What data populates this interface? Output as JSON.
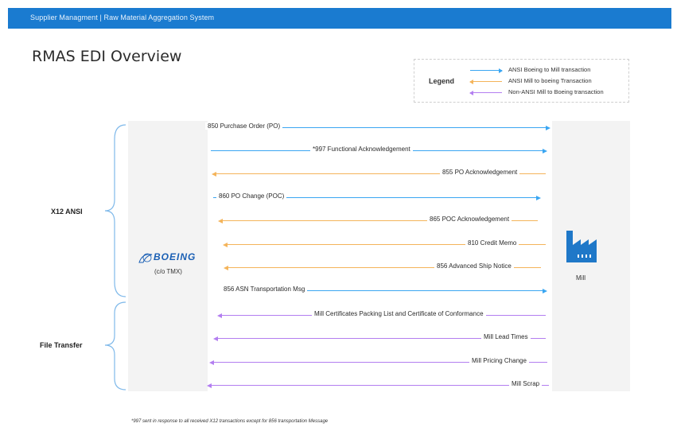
{
  "header": {
    "title": "Supplier Managment | Raw Material Aggregation System"
  },
  "page": {
    "title": "RMAS EDI Overview"
  },
  "legend": {
    "title": "Legend",
    "items": [
      {
        "label": "ANSI Boeing to Mill transaction",
        "color": "#3aa6f2",
        "direction": "right"
      },
      {
        "label": "ANSI Mill to boeing Transaction",
        "color": "#f4b45a",
        "direction": "left"
      },
      {
        "label": "Non-ANSI Mill to Boeing transaction",
        "color": "#b37ef0",
        "direction": "left"
      }
    ]
  },
  "groups": [
    {
      "label": "X12 ANSI"
    },
    {
      "label": "File Transfer"
    }
  ],
  "entities": {
    "left": {
      "logo": "BOEING",
      "sub": "(c/o TMX)",
      "icon": "boeing-logo-icon"
    },
    "right": {
      "label": "Mill",
      "icon": "factory-icon"
    }
  },
  "flows": [
    {
      "label": "850 Purchase Order (PO)",
      "type": "blue"
    },
    {
      "label": "*997 Functional Acknowledgement",
      "type": "blue"
    },
    {
      "label": "855 PO Acknowledgement",
      "type": "orange"
    },
    {
      "label": "860 PO Change (POC)",
      "type": "blue"
    },
    {
      "label": "865 POC Acknowledgement",
      "type": "orange"
    },
    {
      "label": "810 Credit Memo",
      "type": "orange"
    },
    {
      "label": "856 Advanced Ship Notice",
      "type": "orange"
    },
    {
      "label": "856 ASN Transportation Msg",
      "type": "blue"
    },
    {
      "label": "Mill Certificates Packing List and Certificate of Conformance",
      "type": "purple"
    },
    {
      "label": "Mill Lead Times",
      "type": "purple"
    },
    {
      "label": "Mill Pricing Change",
      "type": "purple"
    },
    {
      "label": "Mill Scrap",
      "type": "purple"
    }
  ],
  "footnote": "*997 sent in response to all received X12 transactions except for 856 transportation Message"
}
